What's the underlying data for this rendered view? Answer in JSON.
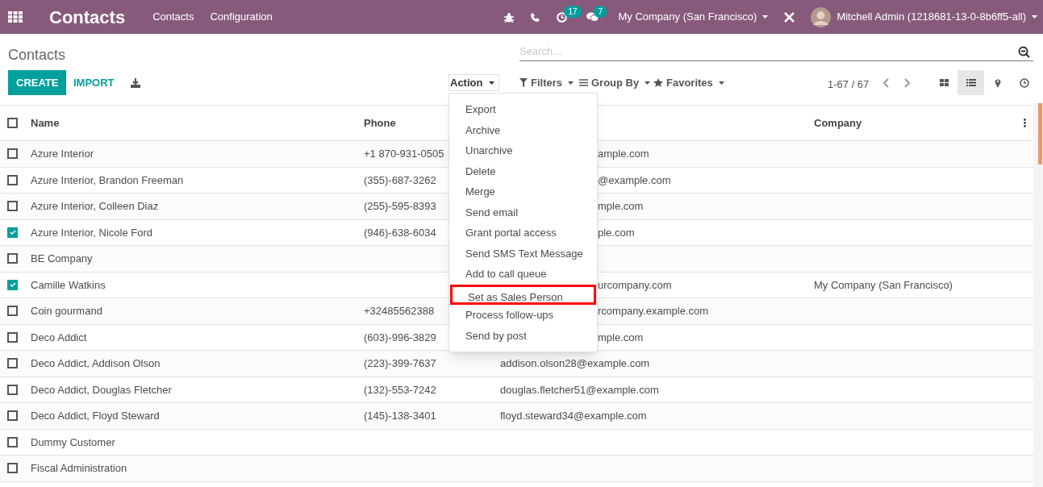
{
  "navbar": {
    "app_title": "Contacts",
    "menus": [
      "Contacts",
      "Configuration"
    ],
    "activity_count": "17",
    "message_count": "7",
    "company": "My Company (San Francisco)",
    "user": "Mitchell Admin (1218681-13-0-8b6ff5-all)"
  },
  "control_panel": {
    "breadcrumb": "Contacts",
    "search": {
      "placeholder": "Search..."
    },
    "create": "CREATE",
    "import": "IMPORT",
    "action": "Action",
    "filters": "Filters",
    "group_by": "Group By",
    "favorites": "Favorites",
    "pager": "1-67 / 67",
    "views": [
      {
        "kind": "kanban",
        "selected": false
      },
      {
        "kind": "list",
        "selected": true
      },
      {
        "kind": "map",
        "selected": false
      },
      {
        "kind": "activity",
        "selected": false
      }
    ]
  },
  "action_menu": {
    "items": [
      {
        "label": "Export",
        "highlighted": false
      },
      {
        "label": "Archive",
        "highlighted": false
      },
      {
        "label": "Unarchive",
        "highlighted": false
      },
      {
        "label": "Delete",
        "highlighted": false
      },
      {
        "label": "Merge",
        "highlighted": false
      },
      {
        "label": "Send email",
        "highlighted": false
      },
      {
        "label": "Grant portal access",
        "highlighted": false
      },
      {
        "label": "Send SMS Text Message",
        "highlighted": false
      },
      {
        "label": "Add to call queue",
        "highlighted": false
      },
      {
        "label": "Set as Sales Person",
        "highlighted": true
      },
      {
        "label": "Process follow-ups",
        "highlighted": false
      },
      {
        "label": "Send by post",
        "highlighted": false
      }
    ]
  },
  "table": {
    "columns": [
      "Name",
      "Phone",
      "Company"
    ],
    "all_checked": false,
    "rows": [
      {
        "checked": false,
        "name": "Azure Interior",
        "phone": "+1 870-931-0505",
        "email": "ample.com",
        "email_covered": true
      },
      {
        "checked": false,
        "name": "Azure Interior, Brandon Freeman",
        "phone": "(355)-687-3262",
        "email": "@example.com",
        "email_covered": true
      },
      {
        "checked": false,
        "name": "Azure Interior, Colleen Diaz",
        "phone": "(255)-595-8393",
        "email": "mple.com",
        "email_covered": true
      },
      {
        "checked": true,
        "name": "Azure Interior, Nicole Ford",
        "phone": "(946)-638-6034",
        "email": "ple.com",
        "email_covered": true
      },
      {
        "checked": false,
        "name": "BE Company"
      },
      {
        "checked": true,
        "name": "Camille Watkins",
        "email": "urcompany.com",
        "email_covered": true,
        "company": "My Company (San Francisco)"
      },
      {
        "checked": false,
        "name": "Coin gourmand",
        "phone": "+32485562388",
        "email": "rcompany.example.com",
        "email_covered": true
      },
      {
        "checked": false,
        "name": "Deco Addict",
        "phone": "(603)-996-3829",
        "email": "mple.com",
        "email_covered": true
      },
      {
        "checked": false,
        "name": "Deco Addict, Addison Olson",
        "phone": "(223)-399-7637",
        "email": "addison.olson28@example.com"
      },
      {
        "checked": false,
        "name": "Deco Addict, Douglas Fletcher",
        "phone": "(132)-553-7242",
        "email": "douglas.fletcher51@example.com"
      },
      {
        "checked": false,
        "name": "Deco Addict, Floyd Steward",
        "phone": "(145)-138-3401",
        "email": "floyd.steward34@example.com"
      },
      {
        "checked": false,
        "name": "Dummy Customer"
      },
      {
        "checked": false,
        "name": "Fiscal Administration"
      }
    ]
  }
}
